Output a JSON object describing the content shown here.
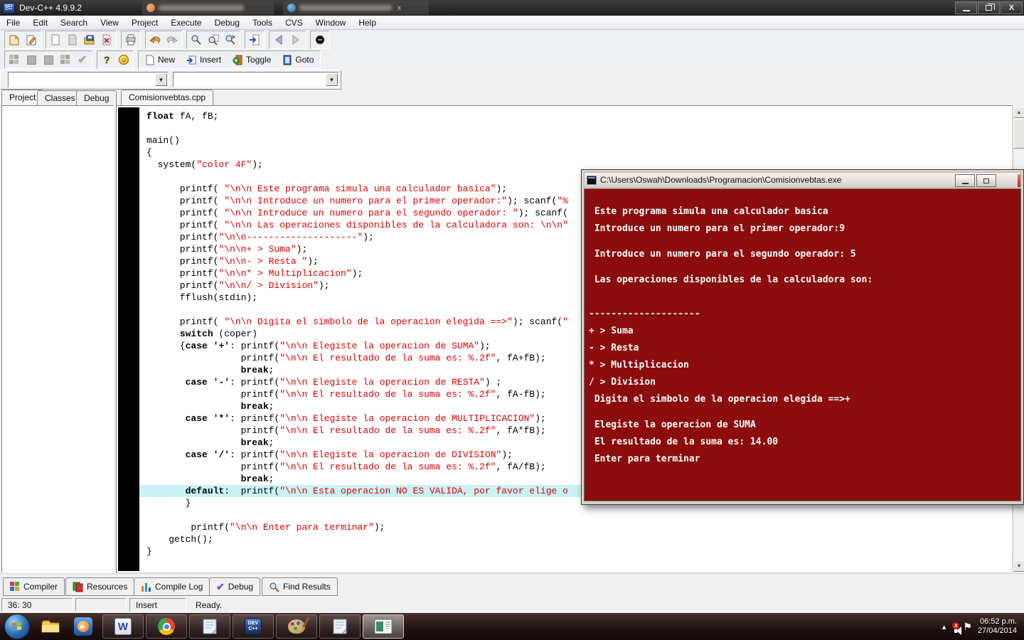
{
  "window": {
    "title": "Dev-C++ 4.9.9.2",
    "buttons": [
      "minimize",
      "restore",
      "close"
    ]
  },
  "menu": {
    "items": [
      "File",
      "Edit",
      "Search",
      "View",
      "Project",
      "Execute",
      "Debug",
      "Tools",
      "CVS",
      "Window",
      "Help"
    ]
  },
  "toolbar1": {
    "icons": [
      "new-source",
      "open-project",
      "new-file",
      "save-disabled",
      "save-as",
      "close-file",
      "print",
      "undo",
      "redo",
      "find",
      "find-in-files",
      "replace",
      "goto-line",
      "back",
      "forward",
      "abort"
    ]
  },
  "toolbar2": {
    "icons": [
      "compile",
      "run",
      "compile-and-run",
      "rebuild",
      "syntax-check",
      "help",
      "about"
    ],
    "buttons": [
      {
        "label": "New"
      },
      {
        "label": "Insert"
      },
      {
        "label": "Toggle"
      },
      {
        "label": "Goto"
      }
    ]
  },
  "compiler_combos": {
    "left_value": "",
    "right_value": ""
  },
  "navigator_tabs": [
    {
      "label": "Project"
    },
    {
      "label": "Classes"
    },
    {
      "label": "Debug"
    }
  ],
  "editor": {
    "file_tab": "Comisionvebtas.cpp",
    "highlight_line": 31,
    "code_lines": [
      "float fA, fB;",
      "",
      "main()",
      "{",
      "  system(\"color 4F\");",
      "",
      "      printf( \"\\n\\n Este programa simula una calculador basica\");",
      "      printf( \"\\n\\n Introduce un numero para el primer operador:\"); scanf(\"%",
      "      printf( \"\\n\\n Introduce un numero para el segundo operador: \"); scanf(",
      "      printf( \"\\n\\n Las operaciones disponibles de la calculadora son: \\n\\n\"",
      "      printf(\"\\n\\n--------------------\");",
      "      printf(\"\\n\\n+ > Suma\");",
      "      printf(\"\\n\\n- > Resta \");",
      "      printf(\"\\n\\n* > Multiplicacion\");",
      "      printf(\"\\n\\n/ > Division\");",
      "      fflush(stdin);",
      "",
      "      printf( \"\\n\\n Digita el simbolo de la operacion elegida ==>\"); scanf(\"",
      "      switch (coper)",
      "      {case '+': printf(\"\\n\\n Elegiste la operacion de SUMA\");",
      "                 printf(\"\\n\\n El resultado de la suma es: %.2f\", fA+fB);",
      "                 break;",
      "       case '-': printf(\"\\n\\n Elegiste la operacion de RESTA\") ;",
      "                 printf(\"\\n\\n El resultado de la suma es: %.2f\", fA-fB);",
      "                 break;",
      "       case '*': printf(\"\\n\\n Elegiste la operacion de MULTIPLICACION\");",
      "                 printf(\"\\n\\n El resultado de la suma es: %.2f\", fA*fB);",
      "                 break;",
      "       case '/': printf(\"\\n\\n Elegiste la operacion de DIVISION\");",
      "                 printf(\"\\n\\n El resultado de la suma es: %.2f\", fA/fB);",
      "                 break;",
      "       default:  printf(\"\\n\\n Esta operacion NO ES VALIDA, por favor elige o",
      "       }",
      "",
      "        printf(\"\\n\\n Enter para terminar\");",
      "    getch();",
      "}"
    ]
  },
  "console": {
    "title": "C:\\Users\\Oswah\\Downloads\\Programacion\\Comisionvebtas.exe",
    "buttons": [
      "minimize",
      "maximize",
      "close"
    ],
    "background_color": "#8b0c0c",
    "text_color": "#ffffff",
    "text": "\n\n Este programa simula una calculador basica\n\n Introduce un numero para el primer operador:9\n\n\n Introduce un numero para el segundo operador: 5\n\n\n Las operaciones disponibles de la calculadora son:\n\n\n\n--------------------\n\n+ > Suma\n\n- > Resta\n\n* > Multiplicacion\n\n/ > Division\n\n Digita el simbolo de la operacion elegida ==>+\n\n\n Elegiste la operacion de SUMA\n\n El resultado de la suma es: 14.00\n\n Enter para terminar"
  },
  "bottom_tabs": [
    {
      "label": "Compiler"
    },
    {
      "label": "Resources"
    },
    {
      "label": "Compile Log"
    },
    {
      "label": "Debug"
    },
    {
      "label": "Find Results"
    }
  ],
  "statusbar": {
    "position": "36: 30",
    "modified": "",
    "mode": "Insert",
    "status": "Ready."
  },
  "taskbar": {
    "items": [
      "start",
      "windows-explorer",
      "media-player",
      "word",
      "chrome",
      "notepad",
      "dev-cpp",
      "paint",
      "notepad",
      "console-active"
    ],
    "tray": [
      "hidden-icons",
      "volume-muted",
      "action-center-flag"
    ],
    "clock": {
      "time": "06:52 p.m.",
      "date": "27/04/2014"
    }
  },
  "colors": {
    "console_red": "#8b0c0c",
    "string_red": "#e00000",
    "line_highlight": "#c9f2f5",
    "titlebar_dark": "#2b2b2b"
  }
}
